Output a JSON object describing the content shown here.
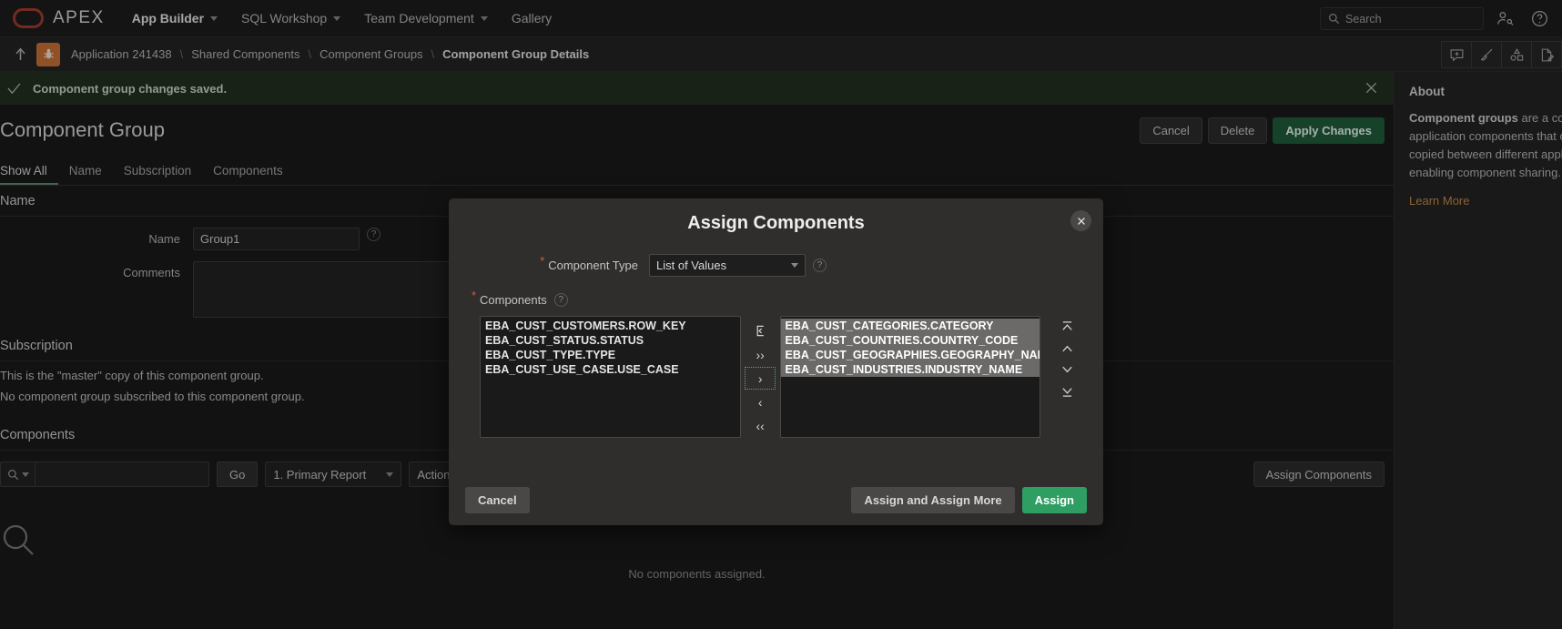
{
  "topnav": {
    "brand": "APEX",
    "items": [
      {
        "label": "App Builder",
        "has_caret": true,
        "active": true
      },
      {
        "label": "SQL Workshop",
        "has_caret": true,
        "active": false
      },
      {
        "label": "Team Development",
        "has_caret": true,
        "active": false
      },
      {
        "label": "Gallery",
        "has_caret": false,
        "active": false
      }
    ],
    "search_placeholder": "Search",
    "search_value": "",
    "account_icon": "user-settings-icon",
    "help_icon": "help-circle-icon"
  },
  "breadcrumb": {
    "up_icon": "up-arrow-icon",
    "app_badge_icon": "bug-icon",
    "items": [
      "Application 241438",
      "Shared Components",
      "Component Groups",
      "Component Group Details"
    ],
    "separator": "\\",
    "right_icons": [
      "comment-add-icon",
      "brush-icon",
      "theme-shapes-icon",
      "page-edit-icon"
    ]
  },
  "alert": {
    "message": "Component group changes saved.",
    "check_icon": "check-icon",
    "close_icon": "close-icon",
    "bg_color": "#22301f"
  },
  "page": {
    "title": "Component Group",
    "buttons": [
      {
        "label": "Cancel",
        "primary": false
      },
      {
        "label": "Delete",
        "primary": false
      },
      {
        "label": "Apply Changes",
        "primary": true
      }
    ]
  },
  "tabs": [
    {
      "label": "Show All",
      "active": true
    },
    {
      "label": "Name",
      "active": false
    },
    {
      "label": "Subscription",
      "active": false
    },
    {
      "label": "Components",
      "active": false
    }
  ],
  "name_region": {
    "heading": "Name",
    "name_label": "Name",
    "name_value": "Group1",
    "comments_label": "Comments",
    "comments_value": "",
    "help_icon": "help-circle-icon"
  },
  "subscription_region": {
    "heading": "Subscription",
    "line1": "This is the \"master\" copy of this component group.",
    "line2": "No component group subscribed to this component group."
  },
  "components_region": {
    "heading": "Components",
    "search_placeholder": "",
    "search_value": "",
    "search_icon": "search-icon",
    "go_label": "Go",
    "report_select": "1. Primary Report",
    "actions_label": "Actions",
    "assign_label": "Assign Components",
    "empty_icon": "search-icon",
    "empty_text": "No components assigned."
  },
  "about": {
    "title": "About",
    "body_lead": "Component groups",
    "body": " are a collection of application components that can be copied between different applications, enabling component sharing.",
    "link": "Learn More"
  },
  "modal": {
    "title": "Assign Components",
    "close_icon": "close-icon",
    "component_type": {
      "label": "Component Type",
      "value": "List of Values",
      "required": true,
      "help_icon": "help-circle-icon",
      "caret_icon": "chevron-down-icon"
    },
    "components": {
      "label": "Components",
      "required": true,
      "help_icon": "help-circle-icon",
      "available": [
        {
          "text": "EBA_CUST_CUSTOMERS.ROW_KEY",
          "selected": false
        },
        {
          "text": "EBA_CUST_STATUS.STATUS",
          "selected": false
        },
        {
          "text": "EBA_CUST_TYPE.TYPE",
          "selected": false
        },
        {
          "text": "EBA_CUST_USE_CASE.USE_CASE",
          "selected": false
        }
      ],
      "assigned": [
        {
          "text": "EBA_CUST_CATEGORIES.CATEGORY",
          "selected": true
        },
        {
          "text": "EBA_CUST_COUNTRIES.COUNTRY_CODE",
          "selected": true
        },
        {
          "text": "EBA_CUST_GEOGRAPHIES.GEOGRAPHY_NAME",
          "selected": true
        },
        {
          "text": "EBA_CUST_INDUSTRIES.INDUSTRY_NAME",
          "selected": true
        }
      ],
      "shuttle_buttons": [
        {
          "name": "reset-icon",
          "glyph": "↶",
          "focused": false
        },
        {
          "name": "move-all-right-icon",
          "glyph": "››",
          "focused": false
        },
        {
          "name": "move-right-icon",
          "glyph": "›",
          "focused": true
        },
        {
          "name": "move-left-icon",
          "glyph": "‹",
          "focused": false
        },
        {
          "name": "move-all-left-icon",
          "glyph": "‹‹",
          "focused": false
        }
      ],
      "sort_buttons": [
        {
          "name": "move-to-top-icon",
          "glyph": "top"
        },
        {
          "name": "move-up-icon",
          "glyph": "up"
        },
        {
          "name": "move-down-icon",
          "glyph": "down"
        },
        {
          "name": "move-to-bottom-icon",
          "glyph": "bottom"
        }
      ]
    },
    "footer": {
      "cancel": "Cancel",
      "assign_and_more": "Assign and Assign More",
      "assign": "Assign"
    },
    "accent_color": "#2f9e63"
  }
}
